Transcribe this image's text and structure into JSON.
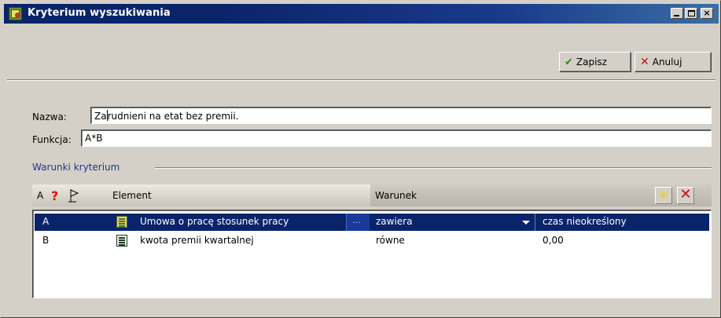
{
  "window": {
    "title": "Kryterium wyszukiwania",
    "icon": "app-icon"
  },
  "toolbar": {
    "save_label": "Zapisz",
    "cancel_label": "Anuluj",
    "save_icon": "check-icon",
    "cancel_icon": "x-icon"
  },
  "form": {
    "name_label": "Nazwa:",
    "name_value_before_caret": "Za",
    "name_value_after_caret": "rudnieni na etat bez premii.",
    "function_label": "Funkcja:",
    "function_value": "A*B"
  },
  "group": {
    "label": "Warunki kryterium"
  },
  "grid": {
    "headers": {
      "a": "A",
      "question": "?",
      "element": "Element",
      "warunek": "Warunek"
    },
    "rows": [
      {
        "a": "A",
        "element": "Umowa o pracę  stosunek pracy",
        "condition": "zawiera",
        "value": "czas nieokreślony",
        "selected": true
      },
      {
        "a": "B",
        "element": "kwota premii kwartalnej",
        "condition": "równe",
        "value": "0,00",
        "selected": false
      }
    ]
  },
  "colors": {
    "title_bar": "#0a246a",
    "selection": "#0a246a",
    "group_label": "#1a3a8a",
    "face": "#d4d0c8"
  }
}
